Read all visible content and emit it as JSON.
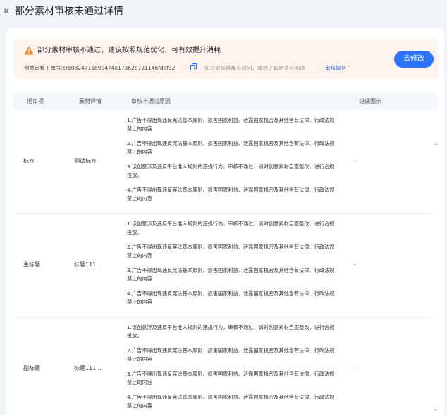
{
  "header": {
    "close_icon": "close-icon",
    "title": "部分素材审核未通过详情"
  },
  "notice": {
    "icon": "warning-icon",
    "icon_color": "#f08a24",
    "message": "部分素材审核不通过，建议按照规范优化，可有效提升消耗",
    "ticket_label": "创意审核工单号:",
    "ticket_id": "cre082471a899474e17a62d721146fddf32",
    "copy_icon": "copy-icon",
    "tip_text": "如对审核结果有疑问，或想了解更多可阅读",
    "tip_link": "审核规范",
    "fix_button": "去修改",
    "accent": "#2b73ff"
  },
  "table": {
    "columns": [
      "拒审项",
      "素材详情",
      "审核不通过原因",
      "错误图示"
    ],
    "rows": [
      {
        "type": "标签",
        "detail": "测试标签",
        "reasons": [
          "1.广告不得出现违反宪法基本原则、损害国家利益、泄露国家机密及其他含有法律、行政法规禁止的内容",
          "2.广告不得出现违反宪法基本原则、损害国家利益、泄露国家机密及其他含有法律、行政法规禁止的内容",
          "3.该创意涉及违反平台准入规则的违规行为，审核不通过，请对创意素材自查整改，进行合规投放。",
          "4.广告不得出现违反宪法基本原则、损害国家利益、泄露国家机密及其他含有法律、行政法规禁止的内容"
        ],
        "error_image": "-"
      },
      {
        "type": "主标题",
        "detail": "标题111...",
        "reasons": [
          "1.该创意涉及违反平台准入规则的违规行为，审核不通过，请对创意素材自查整改，进行合规投放。",
          "2.广告不得出现违反宪法基本原则、损害国家利益、泄露国家机密及其他含有法律、行政法规禁止的内容",
          "3.广告不得出现违反宪法基本原则、损害国家利益、泄露国家机密及其他含有法律、行政法规禁止的内容",
          "4.广告不得出现违反宪法基本原则、损害国家利益、泄露国家机密及其他含有法律、行政法规禁止的内容"
        ],
        "error_image": "-"
      },
      {
        "type": "副标题",
        "detail": "标题111...",
        "reasons": [
          "1.该创意涉及违反平台准入规则的违规行为，审核不通过，请对创意素材自查整改，进行合规投放。",
          "2.广告不得出现违反宪法基本原则、损害国家利益、泄露国家机密及其他含有法律、行政法规禁止的内容",
          "3.广告不得出现违反宪法基本原则、损害国家利益、泄露国家机密及其他含有法律、行政法规禁止的内容",
          "4.广告不得出现违反宪法基本原则、损害国家利益、泄露国家机密及其他含有法律、行政法规禁止的内容"
        ],
        "error_image": "-"
      }
    ]
  }
}
